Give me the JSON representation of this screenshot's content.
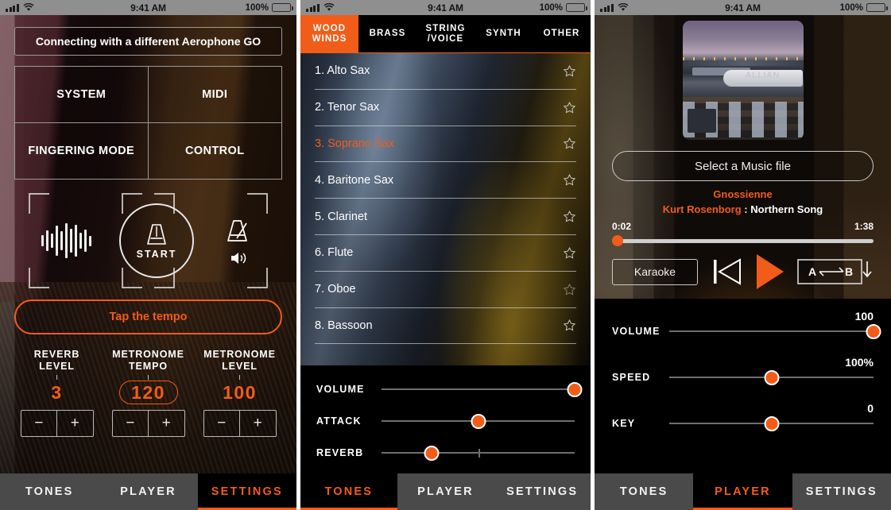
{
  "status_bar": {
    "time": "9:41 AM",
    "battery": "100%",
    "signal_icon": "signal-bars-icon",
    "wifi_icon": "wifi-icon",
    "battery_icon": "battery-icon"
  },
  "accent_color": "#f25c19",
  "panel_settings": {
    "connect_label": "Connecting with a different Aerophone GO",
    "menu": [
      {
        "label": "SYSTEM"
      },
      {
        "label": "MIDI"
      },
      {
        "label": "FINGERING MODE"
      },
      {
        "label": "CONTROL"
      }
    ],
    "waveform_icon": "waveform-icon",
    "metronome_icon": "metronome-icon",
    "speaker_icon": "speaker-icon",
    "start_label": "START",
    "tap_tempo_label": "Tap the tempo",
    "knobs": [
      {
        "label_line1": "REVERB",
        "label_line2": "LEVEL",
        "value": "3",
        "boxed": false,
        "minus": "−",
        "plus": "+"
      },
      {
        "label_line1": "METRONOME",
        "label_line2": "TEMPO",
        "value": "120",
        "boxed": true,
        "minus": "−",
        "plus": "+"
      },
      {
        "label_line1": "METRONOME",
        "label_line2": "LEVEL",
        "value": "100",
        "boxed": false,
        "minus": "−",
        "plus": "+"
      }
    ],
    "nav": [
      {
        "label": "TONES",
        "active": false
      },
      {
        "label": "PLAYER",
        "active": false
      },
      {
        "label": "SETTINGS",
        "active": true
      }
    ]
  },
  "panel_tones": {
    "categories": [
      {
        "line1": "WOOD",
        "line2": "WINDS",
        "active": true
      },
      {
        "line1": "BRASS",
        "line2": "",
        "active": false
      },
      {
        "line1": "STRING",
        "line2": "/VOICE",
        "active": false
      },
      {
        "line1": "SYNTH",
        "line2": "",
        "active": false
      },
      {
        "line1": "OTHER",
        "line2": "",
        "active": false
      }
    ],
    "instruments": [
      {
        "name": "1. Alto Sax",
        "selected": false,
        "star_icon": "star-outline-icon"
      },
      {
        "name": "2. Tenor Sax",
        "selected": false,
        "star_icon": "star-outline-icon"
      },
      {
        "name": "3. Soprano Sax",
        "selected": true,
        "star_icon": "star-outline-icon"
      },
      {
        "name": "4. Baritone Sax",
        "selected": false,
        "star_icon": "star-outline-icon"
      },
      {
        "name": "5. Clarinet",
        "selected": false,
        "star_icon": "star-outline-icon"
      },
      {
        "name": "6. Flute",
        "selected": false,
        "star_icon": "star-outline-icon"
      },
      {
        "name": "7. Oboe",
        "selected": false,
        "star_icon": "star-outline-icon"
      },
      {
        "name": "8. Bassoon",
        "selected": false,
        "star_icon": "star-outline-icon"
      }
    ],
    "sliders": [
      {
        "label": "VOLUME",
        "percent": 100,
        "has_center_tick": false
      },
      {
        "label": "ATTACK",
        "percent": 50,
        "has_center_tick": false
      },
      {
        "label": "REVERB",
        "percent": 26,
        "has_center_tick": true
      }
    ],
    "nav": [
      {
        "label": "TONES",
        "active": true
      },
      {
        "label": "PLAYER",
        "active": false
      },
      {
        "label": "SETTINGS",
        "active": false
      }
    ]
  },
  "panel_player": {
    "album_art_name": "album-artwork",
    "album_art_text": "ALLIAN",
    "select_file_label": "Select a Music file",
    "song_title": "Gnossienne",
    "artist": "Kurt Rosenborg",
    "song_separator": " : ",
    "album_name": "Northern Song",
    "time_current": "0:02",
    "time_total": "1:38",
    "progress_percent": 2,
    "karaoke_label": "Karaoke",
    "prev_icon": "previous-track-icon",
    "play_icon": "play-icon",
    "ab_loop_icon": "ab-loop-icon",
    "ab_a_label": "A",
    "ab_b_label": "B",
    "sliders": [
      {
        "label": "VOLUME",
        "value": "100",
        "percent": 100
      },
      {
        "label": "SPEED",
        "value": "100%",
        "percent": 50
      },
      {
        "label": "KEY",
        "value": "0",
        "percent": 50
      }
    ],
    "nav": [
      {
        "label": "TONES",
        "active": false
      },
      {
        "label": "PLAYER",
        "active": true
      },
      {
        "label": "SETTINGS",
        "active": false
      }
    ]
  }
}
